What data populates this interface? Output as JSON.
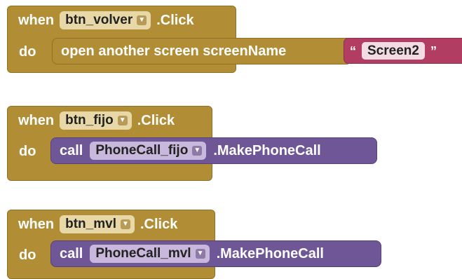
{
  "blocks": [
    {
      "event": {
        "when_label": "when",
        "component": "btn_volver",
        "event_name": ".Click",
        "do_label": "do"
      },
      "statement": {
        "label": "open another screen  screenName"
      },
      "argument": {
        "open_quote": "“",
        "value": "Screen2",
        "close_quote": "”"
      }
    },
    {
      "event": {
        "when_label": "when",
        "component": "btn_fijo",
        "event_name": ".Click",
        "do_label": "do"
      },
      "statement": {
        "call_label": "call",
        "component": "PhoneCall_fijo",
        "method": ".MakePhoneCall"
      }
    },
    {
      "event": {
        "when_label": "when",
        "component": "btn_mvl",
        "event_name": ".Click",
        "do_label": "do"
      },
      "statement": {
        "call_label": "call",
        "component": "PhoneCall_mvl",
        "method": ".MakePhoneCall"
      }
    }
  ],
  "icons": {
    "dropdown": "chevron-down-icon"
  },
  "colors": {
    "event_block": "#b18e35",
    "event_border": "#8e7027",
    "dropdown_gold": "#e8d8a7",
    "call_block": "#6f5697",
    "call_dropdown": "#c8b8dc",
    "text_block": "#b23d63",
    "text_field": "#f2dbe3"
  }
}
